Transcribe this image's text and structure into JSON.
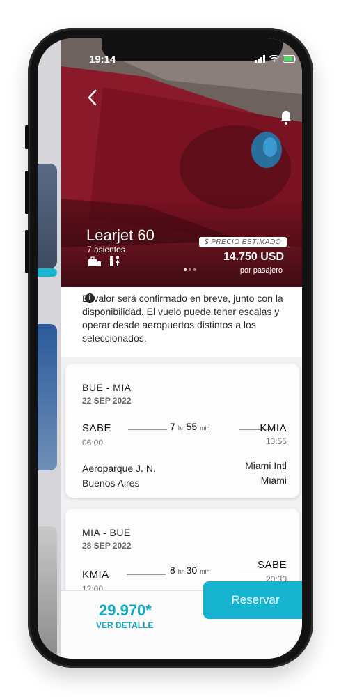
{
  "status_bar": {
    "time": "19:14"
  },
  "aircraft": {
    "name": "Learjet 60",
    "seats": "7 asientos",
    "icons": [
      "luggage-icon",
      "restroom-icon"
    ]
  },
  "price": {
    "tag": "$ PRECIO ESTIMADO",
    "value": "14.750 USD",
    "unit": "por pasajero"
  },
  "notice": {
    "icon": "info-icon",
    "text": "El valor será confirmado en breve, junto con la disponibilidad. El vuelo puede tener escalas y operar desde aeropuertos distintos a los seleccionados."
  },
  "legs": [
    {
      "route": "BUE - MIA",
      "date": "22 SEP 2022",
      "from_code": "SABE",
      "from_time": "06:00",
      "dur_h": "7",
      "dur_h_unit": "hr",
      "dur_m": "55",
      "dur_m_unit": "min",
      "to_code": "KMIA",
      "to_time": "13:55",
      "from_place_1": "Aeroparque J. N.",
      "from_place_2": "Buenos Aires",
      "to_place_1": "Miami Intl",
      "to_place_2": "Miami"
    },
    {
      "route": "MIA - BUE",
      "date": "28 SEP 2022",
      "from_code": "KMIA",
      "from_time": "12:00",
      "dur_h": "8",
      "dur_h_unit": "hr",
      "dur_m": "30",
      "dur_m_unit": "min",
      "to_code": "SABE",
      "to_time": "20:30"
    }
  ],
  "footer": {
    "total": "29.970*",
    "detail": "VER DETALLE",
    "reserve": "Reservar"
  },
  "colors": {
    "accent": "#16b3cf",
    "accent_text": "#13a7c3"
  }
}
